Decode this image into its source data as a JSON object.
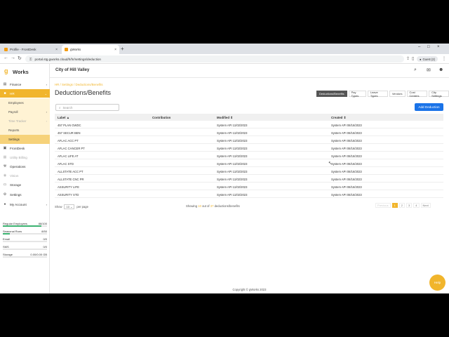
{
  "browser": {
    "tabs": [
      {
        "title": "Profile - FrontDesk"
      },
      {
        "title": "gWorks"
      }
    ],
    "url": "portal.stg.gworks.cloud/h/hr/settings/deduction",
    "guest_label": "Guest (2)"
  },
  "sidebar": {
    "logo_g": "g",
    "logo_word": "Works",
    "items": [
      {
        "label": "Finance",
        "icon": "finance-icon"
      },
      {
        "label": "HR",
        "icon": "hr-icon"
      },
      {
        "label": "FrontDesk",
        "icon": "frontdesk-icon"
      },
      {
        "label": "Utility Billing",
        "icon": "utility-icon"
      },
      {
        "label": "Operations",
        "icon": "operations-icon"
      },
      {
        "label": "Vision",
        "icon": "vision-icon"
      },
      {
        "label": "Storage",
        "icon": "storage-icon"
      },
      {
        "label": "Settings",
        "icon": "settings-icon"
      },
      {
        "label": "My Account",
        "icon": "account-icon"
      }
    ],
    "hr_sub": [
      "Employees",
      "Payroll",
      "Time Tracker",
      "Reports",
      "Settings"
    ],
    "quotas": [
      {
        "label": "Regular Employees",
        "value": "88/100",
        "fill": 0.88
      },
      {
        "label": "Seasonal Runs",
        "value": "8/50",
        "fill": 0.16
      },
      {
        "label": "Email",
        "value": "0/0",
        "fill": 0
      },
      {
        "label": "SMS",
        "value": "0/0",
        "fill": 0
      },
      {
        "label": "Storage",
        "value": "0.00/0.00 GB",
        "fill": 0
      }
    ]
  },
  "header": {
    "city": "City of Hill Valley"
  },
  "breadcrumb": "HR / Settings / Deductions/Benefits",
  "page_title": "Deductions/Benefits",
  "page_tabs": [
    "Deductions/Benefits",
    "Pay Types",
    "Leave Types",
    "Vendors",
    "Cost Centers",
    "City Settings"
  ],
  "search_placeholder": "Search",
  "add_button": "Add Deduction",
  "table": {
    "headers": [
      "Label",
      "Contribution",
      "Modified",
      "Created"
    ],
    "rows": [
      [
        "457 PLAN GWDC",
        "",
        "System API 11/02/2023",
        "System API 08/16/2023"
      ],
      [
        "457 SECUR BEN",
        "",
        "System API 11/02/2023",
        "System API 08/16/2023"
      ],
      [
        "AFLAC ACC PT",
        "",
        "System API 11/02/2023",
        "System API 08/16/2023"
      ],
      [
        "AFLAC CANCER PT",
        "",
        "System API 11/02/2023",
        "System API 08/16/2023"
      ],
      [
        "AFLAC LIFE AT",
        "",
        "System API 11/02/2023",
        "System API 08/16/2023"
      ],
      [
        "AFLAC STD",
        "",
        "System API 11/02/2023",
        "System API 08/16/2023"
      ],
      [
        "ALLSTATE ACC PT",
        "",
        "System API 11/02/2023",
        "System API 08/16/2023"
      ],
      [
        "ALLSTATE CNC PR",
        "",
        "System API 11/02/2023",
        "System API 08/16/2023"
      ],
      [
        "ASSURITY LIFE",
        "",
        "System API 11/02/2023",
        "System API 08/16/2023"
      ],
      [
        "ASSURITY STD",
        "",
        "System API 11/02/2023",
        "System API 08/16/2023"
      ]
    ]
  },
  "pager": {
    "show_label": "Show",
    "show_value": "10",
    "per_page": "per page",
    "showing_pre": "Showing",
    "showing_count": "10",
    "showing_mid": "out of",
    "showing_total": "37",
    "showing_post": "deductions/benefits",
    "previous": "Previous",
    "pages": [
      "1",
      "2",
      "3",
      "4"
    ],
    "next": "Next"
  },
  "footer": "Copyright © gWorks 2023",
  "help_label": "Help",
  "colors": {
    "accent": "#f1b52c",
    "primary": "#1a73e8"
  }
}
